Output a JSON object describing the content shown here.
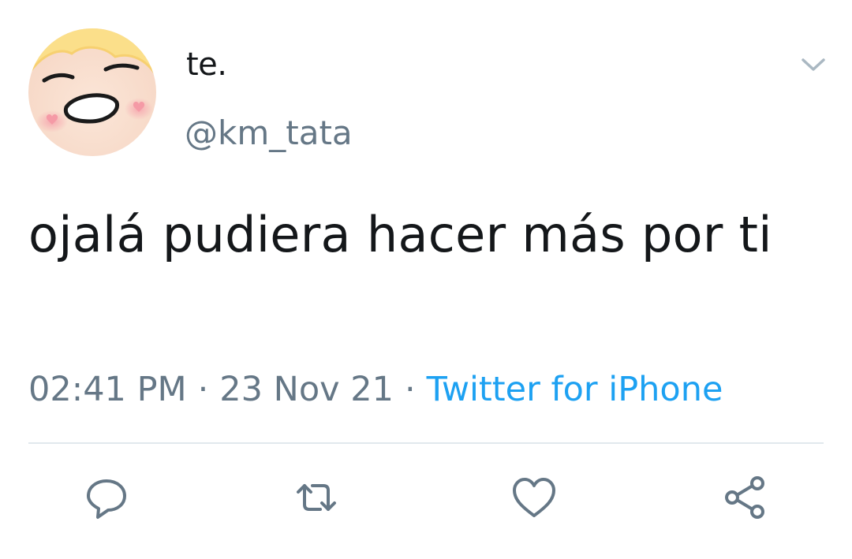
{
  "tweet": {
    "author": {
      "display_name": "te.",
      "handle": "@km_tata",
      "avatar_icon": "blushing-face-avatar"
    },
    "text": "ojalá pudiera hacer más por ti",
    "meta": {
      "time": "02:41 PM",
      "separator": "·",
      "date": "23 Nov 21",
      "source": "Twitter for iPhone"
    },
    "menu_icon": "chevron-down-icon",
    "actions": [
      {
        "name": "reply",
        "icon": "reply-bubble-icon"
      },
      {
        "name": "retweet",
        "icon": "retweet-icon"
      },
      {
        "name": "like",
        "icon": "heart-icon"
      },
      {
        "name": "share",
        "icon": "share-icon"
      }
    ]
  },
  "colors": {
    "text_primary": "#14171a",
    "text_secondary": "#657786",
    "link": "#1da1f2",
    "divider": "#e1e8ed"
  }
}
